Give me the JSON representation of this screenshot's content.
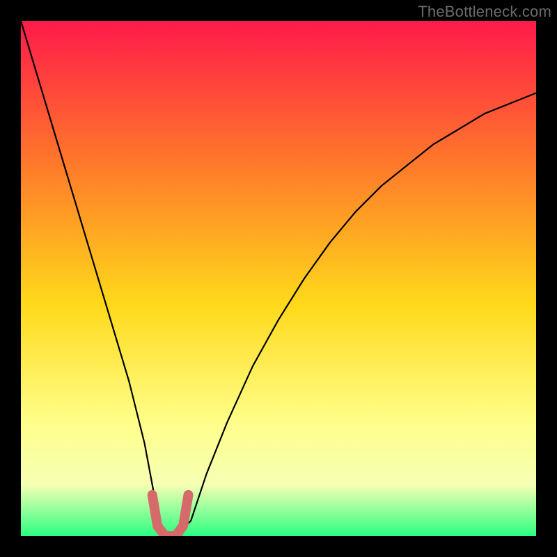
{
  "attribution": "TheBottleneck.com",
  "colors": {
    "frame_bg": "#000000",
    "gradient_top": "#ff1a4a",
    "gradient_mid1": "#ff7a2a",
    "gradient_mid2": "#ffd91a",
    "gradient_mid3": "#ffff8a",
    "gradient_band": "#f6ffb3",
    "gradient_bottom": "#2cff81",
    "curve": "#000000",
    "highlight": "#d66a6a"
  },
  "chart_data": {
    "type": "line",
    "title": "",
    "xlabel": "",
    "ylabel": "",
    "xlim": [
      0,
      100
    ],
    "ylim": [
      0,
      100
    ],
    "series": [
      {
        "name": "bottleneck-curve",
        "x": [
          0,
          3,
          6,
          9,
          12,
          15,
          18,
          21,
          24,
          25.5,
          27,
          28.5,
          30,
          33,
          36,
          40,
          45,
          50,
          55,
          60,
          65,
          70,
          75,
          80,
          85,
          90,
          95,
          100
        ],
        "y": [
          100,
          90,
          80,
          70,
          60,
          50,
          40,
          30,
          18,
          10,
          2,
          0,
          0,
          3,
          12,
          22,
          33,
          42,
          50,
          57,
          63,
          68,
          72,
          76,
          79,
          82,
          84,
          86
        ]
      },
      {
        "name": "optimal-highlight",
        "x": [
          25.5,
          26.5,
          28,
          30,
          31.5,
          32.5
        ],
        "y": [
          8,
          2,
          0,
          0,
          2,
          8
        ]
      }
    ],
    "annotations": []
  }
}
